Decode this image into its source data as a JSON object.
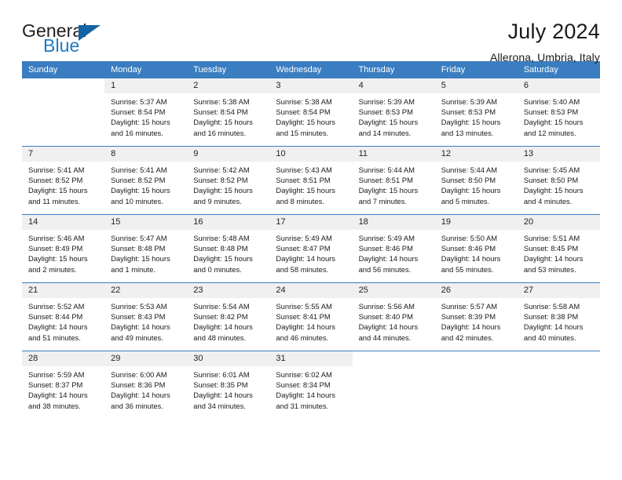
{
  "brand": {
    "word_one": "General",
    "word_two": "Blue",
    "triangle_icon": "brand-triangle-icon",
    "accent_color": "#1464a5",
    "blue_text_color": "#1f7ac0"
  },
  "header": {
    "month_title": "July 2024",
    "location": "Allerona, Umbria, Italy"
  },
  "calendar": {
    "header_bg": "#3a7dc0",
    "daynum_bg": "#f0f0f0",
    "weekday_headers": [
      "Sunday",
      "Monday",
      "Tuesday",
      "Wednesday",
      "Thursday",
      "Friday",
      "Saturday"
    ],
    "weeks": [
      [
        {
          "day": "",
          "sunrise": "",
          "sunset": "",
          "daylight_line1": "",
          "daylight_line2": ""
        },
        {
          "day": "1",
          "sunrise": "Sunrise: 5:37 AM",
          "sunset": "Sunset: 8:54 PM",
          "daylight_line1": "Daylight: 15 hours",
          "daylight_line2": "and 16 minutes."
        },
        {
          "day": "2",
          "sunrise": "Sunrise: 5:38 AM",
          "sunset": "Sunset: 8:54 PM",
          "daylight_line1": "Daylight: 15 hours",
          "daylight_line2": "and 16 minutes."
        },
        {
          "day": "3",
          "sunrise": "Sunrise: 5:38 AM",
          "sunset": "Sunset: 8:54 PM",
          "daylight_line1": "Daylight: 15 hours",
          "daylight_line2": "and 15 minutes."
        },
        {
          "day": "4",
          "sunrise": "Sunrise: 5:39 AM",
          "sunset": "Sunset: 8:53 PM",
          "daylight_line1": "Daylight: 15 hours",
          "daylight_line2": "and 14 minutes."
        },
        {
          "day": "5",
          "sunrise": "Sunrise: 5:39 AM",
          "sunset": "Sunset: 8:53 PM",
          "daylight_line1": "Daylight: 15 hours",
          "daylight_line2": "and 13 minutes."
        },
        {
          "day": "6",
          "sunrise": "Sunrise: 5:40 AM",
          "sunset": "Sunset: 8:53 PM",
          "daylight_line1": "Daylight: 15 hours",
          "daylight_line2": "and 12 minutes."
        }
      ],
      [
        {
          "day": "7",
          "sunrise": "Sunrise: 5:41 AM",
          "sunset": "Sunset: 8:52 PM",
          "daylight_line1": "Daylight: 15 hours",
          "daylight_line2": "and 11 minutes."
        },
        {
          "day": "8",
          "sunrise": "Sunrise: 5:41 AM",
          "sunset": "Sunset: 8:52 PM",
          "daylight_line1": "Daylight: 15 hours",
          "daylight_line2": "and 10 minutes."
        },
        {
          "day": "9",
          "sunrise": "Sunrise: 5:42 AM",
          "sunset": "Sunset: 8:52 PM",
          "daylight_line1": "Daylight: 15 hours",
          "daylight_line2": "and 9 minutes."
        },
        {
          "day": "10",
          "sunrise": "Sunrise: 5:43 AM",
          "sunset": "Sunset: 8:51 PM",
          "daylight_line1": "Daylight: 15 hours",
          "daylight_line2": "and 8 minutes."
        },
        {
          "day": "11",
          "sunrise": "Sunrise: 5:44 AM",
          "sunset": "Sunset: 8:51 PM",
          "daylight_line1": "Daylight: 15 hours",
          "daylight_line2": "and 7 minutes."
        },
        {
          "day": "12",
          "sunrise": "Sunrise: 5:44 AM",
          "sunset": "Sunset: 8:50 PM",
          "daylight_line1": "Daylight: 15 hours",
          "daylight_line2": "and 5 minutes."
        },
        {
          "day": "13",
          "sunrise": "Sunrise: 5:45 AM",
          "sunset": "Sunset: 8:50 PM",
          "daylight_line1": "Daylight: 15 hours",
          "daylight_line2": "and 4 minutes."
        }
      ],
      [
        {
          "day": "14",
          "sunrise": "Sunrise: 5:46 AM",
          "sunset": "Sunset: 8:49 PM",
          "daylight_line1": "Daylight: 15 hours",
          "daylight_line2": "and 2 minutes."
        },
        {
          "day": "15",
          "sunrise": "Sunrise: 5:47 AM",
          "sunset": "Sunset: 8:48 PM",
          "daylight_line1": "Daylight: 15 hours",
          "daylight_line2": "and 1 minute."
        },
        {
          "day": "16",
          "sunrise": "Sunrise: 5:48 AM",
          "sunset": "Sunset: 8:48 PM",
          "daylight_line1": "Daylight: 15 hours",
          "daylight_line2": "and 0 minutes."
        },
        {
          "day": "17",
          "sunrise": "Sunrise: 5:49 AM",
          "sunset": "Sunset: 8:47 PM",
          "daylight_line1": "Daylight: 14 hours",
          "daylight_line2": "and 58 minutes."
        },
        {
          "day": "18",
          "sunrise": "Sunrise: 5:49 AM",
          "sunset": "Sunset: 8:46 PM",
          "daylight_line1": "Daylight: 14 hours",
          "daylight_line2": "and 56 minutes."
        },
        {
          "day": "19",
          "sunrise": "Sunrise: 5:50 AM",
          "sunset": "Sunset: 8:46 PM",
          "daylight_line1": "Daylight: 14 hours",
          "daylight_line2": "and 55 minutes."
        },
        {
          "day": "20",
          "sunrise": "Sunrise: 5:51 AM",
          "sunset": "Sunset: 8:45 PM",
          "daylight_line1": "Daylight: 14 hours",
          "daylight_line2": "and 53 minutes."
        }
      ],
      [
        {
          "day": "21",
          "sunrise": "Sunrise: 5:52 AM",
          "sunset": "Sunset: 8:44 PM",
          "daylight_line1": "Daylight: 14 hours",
          "daylight_line2": "and 51 minutes."
        },
        {
          "day": "22",
          "sunrise": "Sunrise: 5:53 AM",
          "sunset": "Sunset: 8:43 PM",
          "daylight_line1": "Daylight: 14 hours",
          "daylight_line2": "and 49 minutes."
        },
        {
          "day": "23",
          "sunrise": "Sunrise: 5:54 AM",
          "sunset": "Sunset: 8:42 PM",
          "daylight_line1": "Daylight: 14 hours",
          "daylight_line2": "and 48 minutes."
        },
        {
          "day": "24",
          "sunrise": "Sunrise: 5:55 AM",
          "sunset": "Sunset: 8:41 PM",
          "daylight_line1": "Daylight: 14 hours",
          "daylight_line2": "and 46 minutes."
        },
        {
          "day": "25",
          "sunrise": "Sunrise: 5:56 AM",
          "sunset": "Sunset: 8:40 PM",
          "daylight_line1": "Daylight: 14 hours",
          "daylight_line2": "and 44 minutes."
        },
        {
          "day": "26",
          "sunrise": "Sunrise: 5:57 AM",
          "sunset": "Sunset: 8:39 PM",
          "daylight_line1": "Daylight: 14 hours",
          "daylight_line2": "and 42 minutes."
        },
        {
          "day": "27",
          "sunrise": "Sunrise: 5:58 AM",
          "sunset": "Sunset: 8:38 PM",
          "daylight_line1": "Daylight: 14 hours",
          "daylight_line2": "and 40 minutes."
        }
      ],
      [
        {
          "day": "28",
          "sunrise": "Sunrise: 5:59 AM",
          "sunset": "Sunset: 8:37 PM",
          "daylight_line1": "Daylight: 14 hours",
          "daylight_line2": "and 38 minutes."
        },
        {
          "day": "29",
          "sunrise": "Sunrise: 6:00 AM",
          "sunset": "Sunset: 8:36 PM",
          "daylight_line1": "Daylight: 14 hours",
          "daylight_line2": "and 36 minutes."
        },
        {
          "day": "30",
          "sunrise": "Sunrise: 6:01 AM",
          "sunset": "Sunset: 8:35 PM",
          "daylight_line1": "Daylight: 14 hours",
          "daylight_line2": "and 34 minutes."
        },
        {
          "day": "31",
          "sunrise": "Sunrise: 6:02 AM",
          "sunset": "Sunset: 8:34 PM",
          "daylight_line1": "Daylight: 14 hours",
          "daylight_line2": "and 31 minutes."
        },
        {
          "day": "",
          "sunrise": "",
          "sunset": "",
          "daylight_line1": "",
          "daylight_line2": ""
        },
        {
          "day": "",
          "sunrise": "",
          "sunset": "",
          "daylight_line1": "",
          "daylight_line2": ""
        },
        {
          "day": "",
          "sunrise": "",
          "sunset": "",
          "daylight_line1": "",
          "daylight_line2": ""
        }
      ]
    ]
  }
}
